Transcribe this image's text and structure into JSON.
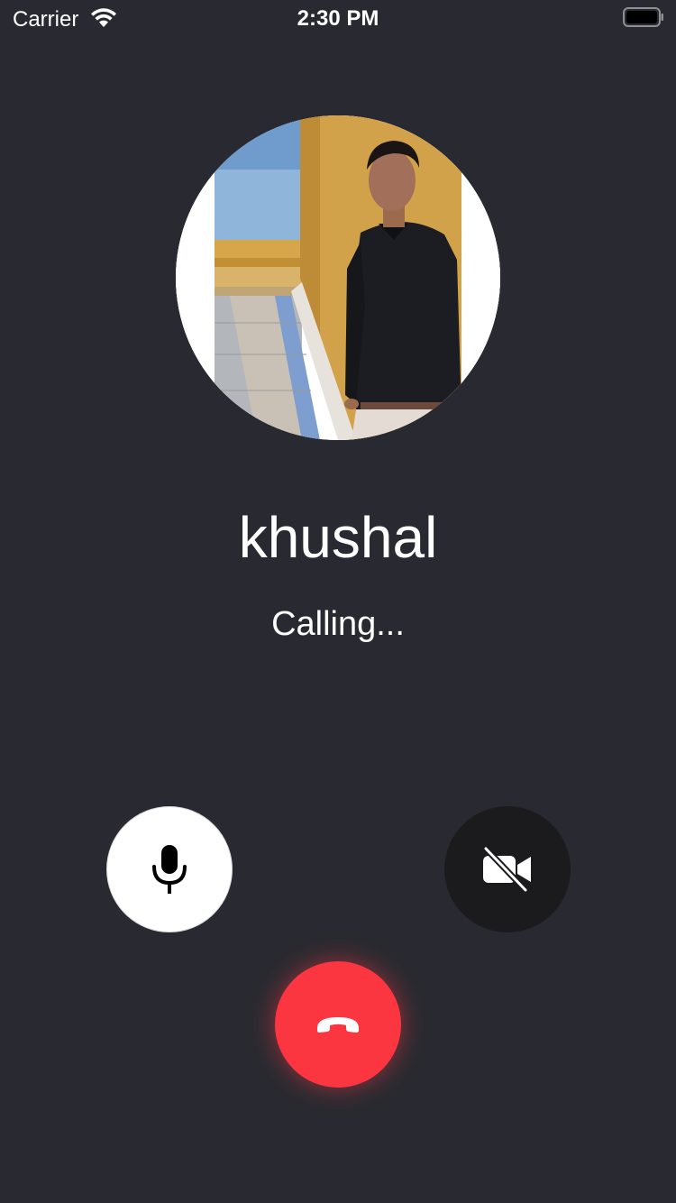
{
  "status_bar": {
    "carrier": "Carrier",
    "time": "2:30 PM",
    "wifi_icon": "wifi-icon",
    "battery_icon": "battery-icon"
  },
  "call": {
    "caller_name": "khushal",
    "status": "Calling..."
  },
  "controls": {
    "mic_icon": "microphone-icon",
    "video_icon": "video-off-icon",
    "end_icon": "phone-hangup-icon",
    "end_color": "#fb3640"
  },
  "colors": {
    "background": "#292a31",
    "mic_button": "#ffffff",
    "video_button": "#1b1b1d"
  }
}
